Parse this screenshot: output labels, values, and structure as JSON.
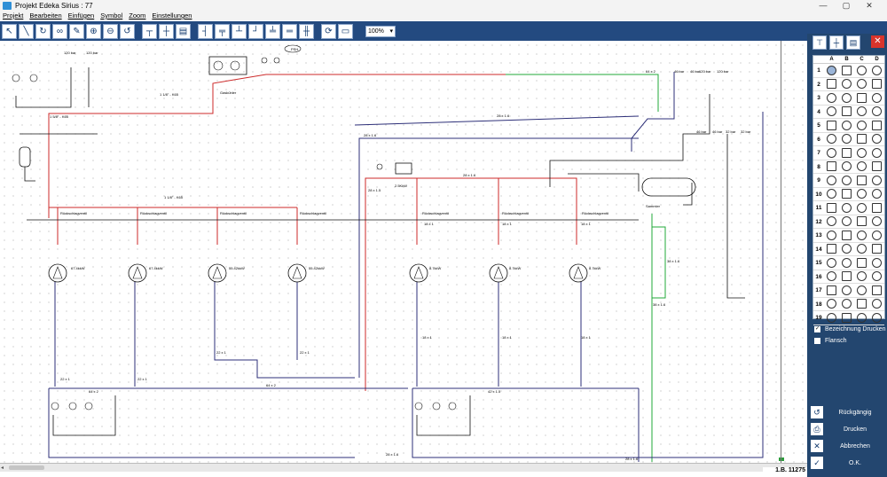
{
  "window": {
    "title": "Projekt Edeka Sirius : 77",
    "minimize": "—",
    "maximize": "▢",
    "close": "✕"
  },
  "menu": [
    "Projekt",
    "Bearbeiten",
    "Einfügen",
    "Symbol",
    "Zoom",
    "Einstellungen"
  ],
  "toolbar": {
    "tools": [
      "select-arrow-icon",
      "line-icon",
      "rotate-icon",
      "link-icon",
      "eraser-icon",
      "zoom-in-icon",
      "zoom-out-icon",
      "undo-icon",
      "pipe-tool-a-icon",
      "pipe-tool-b-icon",
      "panel-icon",
      "connector-a-icon",
      "connector-b-icon",
      "connector-c-icon",
      "connector-d-icon",
      "connector-e-icon",
      "connector-f-icon",
      "connector-g-icon",
      "refresh-icon",
      "open-folder-icon"
    ],
    "zoom": "100%"
  },
  "drawing": {
    "top_labels": [
      "120 bar",
      "120 bar",
      "Gaskühler",
      "1 1/8\" - K65",
      "1 5/8\" - K65",
      "PSH",
      "64 x 2",
      "46 bar",
      "46 bar",
      "120 bar",
      "120 bar",
      "28 x 1.6",
      "28 x 1.6",
      "46 bar",
      "46 bar",
      "32 bar",
      "32 bar",
      "28 x 1.5",
      "2.5KkW",
      "28 x 1.6",
      "Sammler"
    ],
    "left_compressors": [
      "67.4kkW",
      "67.4kkW",
      "55.42kkW",
      "55.42kkW"
    ],
    "right_compressors": [
      "8.7kkW",
      "8.7kkW",
      "8.7kkW"
    ],
    "valve_label": "Rückschlagventil",
    "main_line": "1 1/8\" - K65",
    "pipe_labels": [
      "18 x 1",
      "18 x 1",
      "18 x 1",
      "22 x 1",
      "22 x 1",
      "22 x 1",
      "22 x 1",
      "18 x 1",
      "18 x 1",
      "18 x 1",
      "64 x 2",
      "64 x 2",
      "42 x 1.5",
      "28 x 1.6",
      "28 x 1.6",
      "38 x 1.6",
      "38 x 1.6"
    ]
  },
  "status": {
    "coord": "1.B. 11275"
  },
  "panel": {
    "columns": [
      "A",
      "B",
      "C",
      "D"
    ],
    "rows": [
      "1",
      "2",
      "3",
      "4",
      "5",
      "6",
      "7",
      "8",
      "9",
      "10",
      "11",
      "12",
      "13",
      "14",
      "15",
      "16",
      "17",
      "18",
      "19"
    ],
    "checks": [
      {
        "label": "Bezeichnung Drucken",
        "checked": true
      },
      {
        "label": "Flansch",
        "checked": false
      }
    ],
    "buttons": [
      {
        "label": "Rückgängig",
        "icon": "undo-icon",
        "glyph": "↺"
      },
      {
        "label": "Drucken",
        "icon": "printer-icon",
        "glyph": "⎙"
      },
      {
        "label": "Abbrechen",
        "icon": "cancel-icon",
        "glyph": "✕"
      },
      {
        "label": "O.K.",
        "icon": "ok-icon",
        "glyph": "✓"
      }
    ]
  },
  "colors": {
    "hot_line": "#cc2a2a",
    "suction_line": "#2d2f78",
    "liquid_line": "#22a83a",
    "panel_bg": "#23466f",
    "toolbar_bg": "#234a80"
  }
}
